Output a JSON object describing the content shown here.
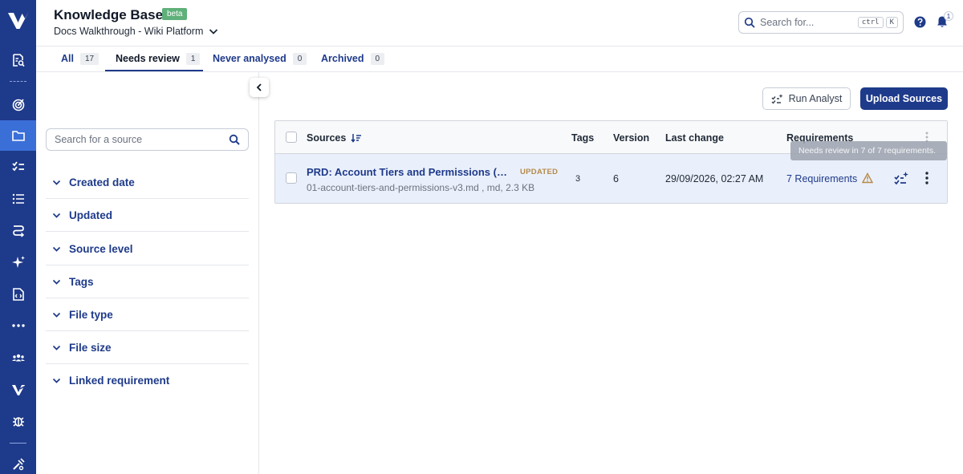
{
  "app": {
    "title": "Knowledge Base",
    "badge": "beta",
    "project": "Docs Walkthrough - Wiki Platform"
  },
  "header": {
    "search_placeholder": "Search for...",
    "kbd_1": "ctrl",
    "kbd_2": "K",
    "notification_count": "1"
  },
  "rail": {
    "icons": [
      "logo-icon",
      "document-search-icon",
      "target-icon",
      "folder-icon",
      "checklist-icon",
      "list-icon",
      "flow-icon",
      "sparkle-icon",
      "code-file-icon",
      "more-horizontal-icon",
      "team-icon",
      "brand-icon",
      "bug-icon",
      "settings-tools-icon"
    ],
    "active": "folder-icon",
    "color": "#1e3a8a",
    "active_color": "#3b6fd8"
  },
  "tabs": [
    {
      "label": "All",
      "count": "17"
    },
    {
      "label": "Needs review",
      "count": "1"
    },
    {
      "label": "Never analysed",
      "count": "0"
    },
    {
      "label": "Archived",
      "count": "0"
    }
  ],
  "active_tab": "Needs review",
  "filters": {
    "search_placeholder": "Search for a source",
    "groups": [
      "Created date",
      "Updated",
      "Source level",
      "Tags",
      "File type",
      "File size",
      "Linked requirement"
    ]
  },
  "actions": {
    "run_analyst": "Run Analyst",
    "upload_sources": "Upload Sources"
  },
  "table": {
    "columns": [
      "Sources",
      "Tags",
      "Version",
      "Last change",
      "Requirements"
    ],
    "rows": [
      {
        "title": "PRD: Account Tiers and Permissions (V...",
        "status": "UPDATED",
        "meta": "01-account-tiers-and-permissions-v3.md , md, 2.3 KB",
        "tags": "3",
        "version": "6",
        "last_change": "29/09/2026, 02:27 AM",
        "requirements": "7 Requirements"
      }
    ]
  },
  "tooltip": "Needs review in 7 of 7 requirements.",
  "colors": {
    "primary": "#1e3a8a",
    "badge_green": "#5fb07a",
    "updated": "#b58a4a",
    "row_highlight": "#eaf0fb"
  }
}
